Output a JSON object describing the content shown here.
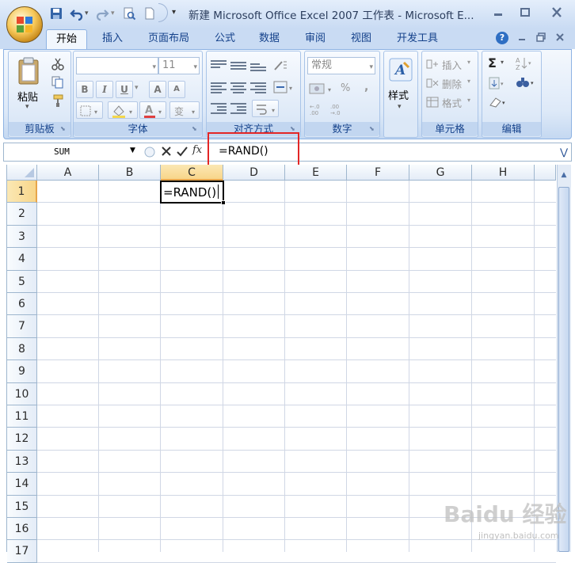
{
  "window": {
    "title": "新建 Microsoft Office Excel 2007 工作表 - Microsoft E..."
  },
  "tabs": [
    "开始",
    "插入",
    "页面布局",
    "公式",
    "数据",
    "审阅",
    "视图",
    "开发工具"
  ],
  "ribbon": {
    "clipboard": {
      "label": "剪贴板",
      "paste_label": "粘贴"
    },
    "font": {
      "label": "字体",
      "font_name": "",
      "font_size": "11"
    },
    "alignment": {
      "label": "对齐方式"
    },
    "number": {
      "label": "数字",
      "format": "常规",
      "percent": "%",
      "comma": ","
    },
    "styles": {
      "label": "样式",
      "styles_label": "样式"
    },
    "cells": {
      "label": "单元格",
      "insert": "插入",
      "delete": "删除",
      "format": "格式"
    },
    "editing": {
      "label": "编辑"
    }
  },
  "formula_bar": {
    "name_box": "SUM",
    "fx": "fx",
    "formula": "=RAND()"
  },
  "grid": {
    "columns": [
      "A",
      "B",
      "C",
      "D",
      "E",
      "F",
      "G",
      "H"
    ],
    "rows": [
      "1",
      "2",
      "3",
      "4",
      "5",
      "6",
      "7",
      "8",
      "9",
      "10",
      "11",
      "12",
      "13",
      "14",
      "15",
      "16",
      "17"
    ],
    "active_cell_value": "=RAND()"
  },
  "watermark": {
    "text": "Baidu 经验",
    "sub": "jingyan.baidu.com"
  }
}
